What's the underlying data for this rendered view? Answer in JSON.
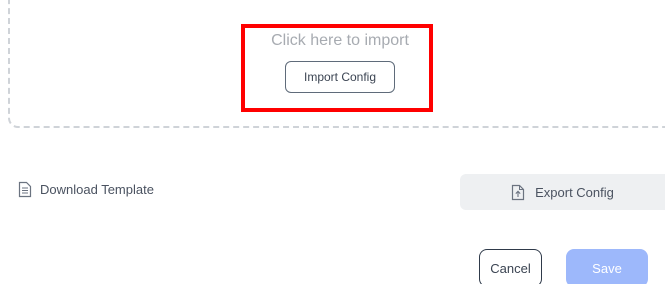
{
  "dropzone": {
    "hint": "Click here to import",
    "import_button_label": "Import Config"
  },
  "download": {
    "label": "Download Template",
    "icon": "document-icon"
  },
  "export": {
    "label": "Export Config",
    "icon": "file-upload-icon"
  },
  "footer": {
    "cancel_label": "Cancel",
    "save_label": "Save"
  },
  "colors": {
    "highlight": "#ff0000",
    "save_disabled": "#9db8fb",
    "export_bg": "#eef0f2",
    "dropzone_border": "#cfd3d8"
  }
}
